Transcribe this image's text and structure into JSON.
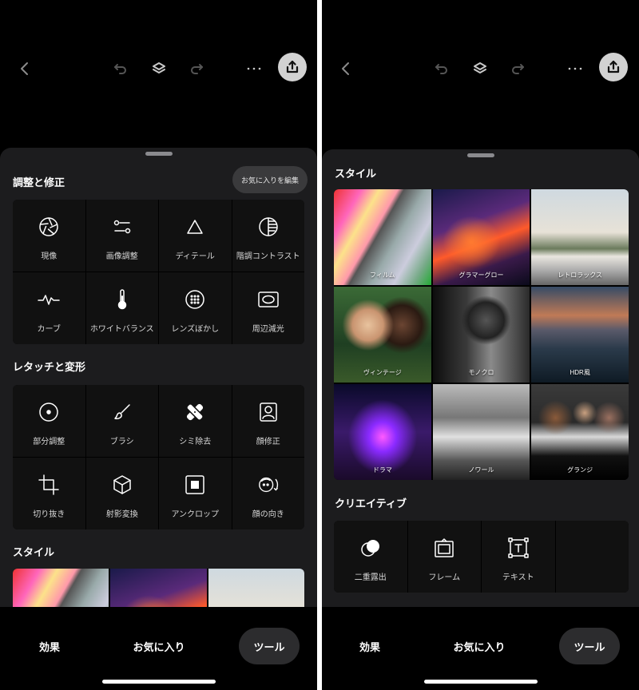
{
  "left": {
    "toolbar": {
      "back_icon": "chevron-left-icon",
      "undo_icon": "undo-icon",
      "layers_icon": "layers-icon",
      "redo_icon": "redo-icon",
      "more_icon": "more-horizontal-icon",
      "export_icon": "share-export-icon"
    },
    "sections": {
      "adjust_title": "調整と修正",
      "fav_edit": "お気に入りを編集",
      "retouch_title": "レタッチと変形",
      "style_title": "スタイル"
    },
    "adjust_tools": [
      {
        "label": "現像",
        "icon": "aperture-icon"
      },
      {
        "label": "画像調整",
        "icon": "sliders-icon"
      },
      {
        "label": "ディテール",
        "icon": "triangle-icon"
      },
      {
        "label": "階調コントラスト",
        "icon": "tonal-contrast-icon"
      },
      {
        "label": "カーブ",
        "icon": "curve-icon"
      },
      {
        "label": "ホワイトバランス",
        "icon": "thermometer-icon"
      },
      {
        "label": "レンズぼかし",
        "icon": "lens-blur-icon"
      },
      {
        "label": "周辺減光",
        "icon": "vignette-icon"
      }
    ],
    "retouch_tools": [
      {
        "label": "部分調整",
        "icon": "selective-icon"
      },
      {
        "label": "ブラシ",
        "icon": "brush-icon"
      },
      {
        "label": "シミ除去",
        "icon": "healing-bandage-icon"
      },
      {
        "label": "顔修正",
        "icon": "face-portrait-icon"
      },
      {
        "label": "切り抜き",
        "icon": "crop-icon"
      },
      {
        "label": "射影変換",
        "icon": "perspective-cube-icon"
      },
      {
        "label": "アンクロップ",
        "icon": "expand-icon"
      },
      {
        "label": "顔の向き",
        "icon": "head-pose-icon"
      }
    ],
    "nav": {
      "effects": "効果",
      "favorites": "お気に入り",
      "tools": "ツール"
    }
  },
  "right": {
    "toolbar": {
      "back_icon": "chevron-left-icon",
      "undo_icon": "undo-icon",
      "layers_icon": "layers-icon",
      "redo_icon": "redo-icon",
      "more_icon": "more-horizontal-icon",
      "export_icon": "share-export-icon"
    },
    "sections": {
      "style_title": "スタイル",
      "creative_title": "クリエイティブ"
    },
    "styles": [
      {
        "label": "フィルム"
      },
      {
        "label": "グラマーグロー"
      },
      {
        "label": "レトロラックス"
      },
      {
        "label": "ヴィンテージ"
      },
      {
        "label": "モノクロ"
      },
      {
        "label": "HDR風"
      },
      {
        "label": "ドラマ"
      },
      {
        "label": "ノワール"
      },
      {
        "label": "グランジ"
      }
    ],
    "creative_tools": [
      {
        "label": "二重露出",
        "icon": "double-exposure-icon"
      },
      {
        "label": "フレーム",
        "icon": "frame-icon"
      },
      {
        "label": "テキスト",
        "icon": "text-tool-icon"
      }
    ],
    "nav": {
      "effects": "効果",
      "favorites": "お気に入り",
      "tools": "ツール"
    }
  }
}
